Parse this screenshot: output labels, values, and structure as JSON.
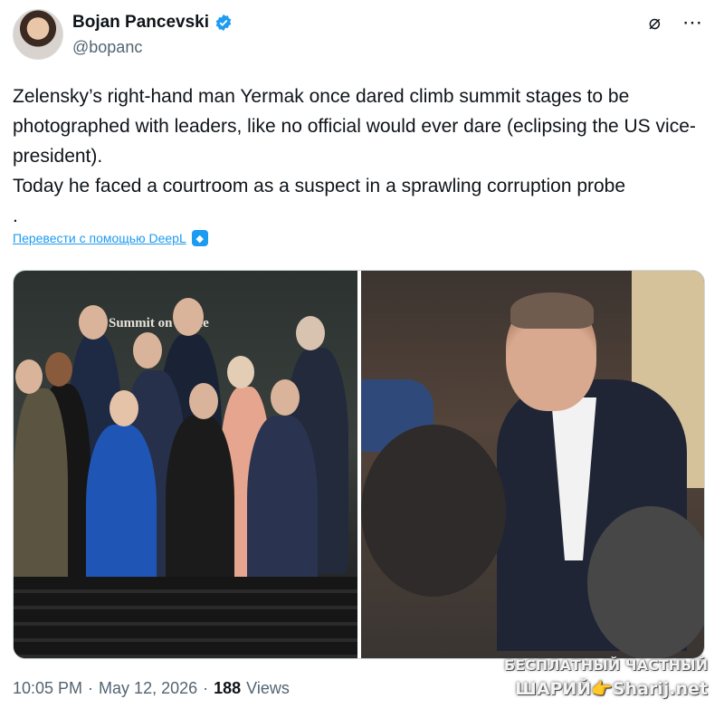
{
  "author": {
    "name": "Bojan Pancevski",
    "handle": "@bopanc",
    "verified": true
  },
  "header_icons": [
    "grok-icon",
    "more-icon"
  ],
  "tweet": {
    "lines": [
      "Zelensky’s right-hand man Yermak once dared climb summit stages to be photographed with leaders, like no official would ever dare (eclipsing the US vice-president).",
      "Today he faced a courtroom as a suspect in a sprawling corruption probe",
      "."
    ],
    "translate_label": "Перевести с помощью DeepL"
  },
  "media": {
    "left_photo_text": "Summit on Peace"
  },
  "meta": {
    "time": "10:05 PM",
    "date": "May 12, 2026",
    "views_count": "188",
    "views_label": "Views"
  },
  "watermark": {
    "line1": "БЕСПЛАТНЫЙ ЧАСТНЫЙ",
    "line2": "ШАРИЙ👉Sharij.net"
  },
  "colors": {
    "link": "#1d9bf0",
    "muted": "#536471",
    "text": "#0f1419"
  }
}
